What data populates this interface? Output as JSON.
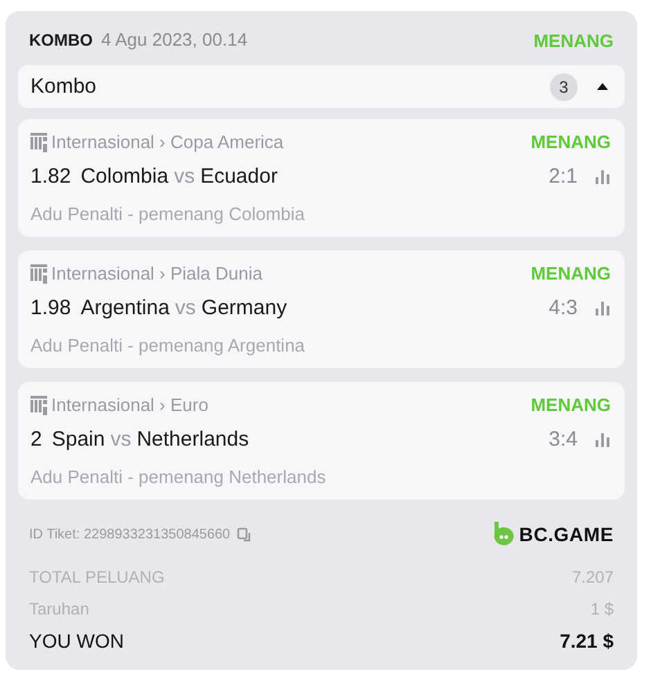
{
  "header": {
    "type": "KOMBO",
    "date": "4 Agu 2023, 00.14",
    "status": "MENANG"
  },
  "group": {
    "label": "Kombo",
    "count": "3",
    "expanded": true
  },
  "matches": [
    {
      "category": "Internasional",
      "separator": "›",
      "league": "Copa America",
      "status": "MENANG",
      "odds": "1.82",
      "home": "Colombia",
      "vs": "vs",
      "away": "Ecuador",
      "score": "2:1",
      "market": "Adu Penalti - pemenang Colombia"
    },
    {
      "category": "Internasional",
      "separator": "›",
      "league": "Piala Dunia",
      "status": "MENANG",
      "odds": "1.98",
      "home": "Argentina",
      "vs": "vs",
      "away": "Germany",
      "score": "4:3",
      "market": "Adu Penalti - pemenang Argentina"
    },
    {
      "category": "Internasional",
      "separator": "›",
      "league": "Euro",
      "status": "MENANG",
      "odds": "2",
      "home": "Spain",
      "vs": "vs",
      "away": "Netherlands",
      "score": "3:4",
      "market": "Adu Penalti - pemenang Netherlands"
    }
  ],
  "ticket": {
    "id": "ID Tiket: 2298933231350845660",
    "brand": "BC.GAME"
  },
  "summary": [
    {
      "label": "TOTAL PELUANG",
      "value": "7.207",
      "kind": "muted"
    },
    {
      "label": "Taruhan",
      "value": "1 $",
      "kind": "muted"
    },
    {
      "label": "YOU WON",
      "value": "7.21 $",
      "kind": "total"
    }
  ]
}
